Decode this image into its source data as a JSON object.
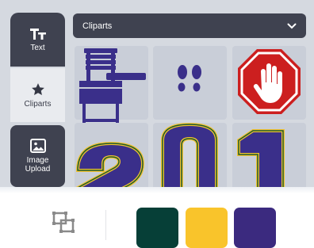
{
  "sidebar": {
    "items": [
      {
        "label": "Text",
        "icon": "text-tt-icon"
      },
      {
        "label": "Cliparts",
        "icon": "star-icon"
      },
      {
        "label": "Image Upload",
        "icon": "image-icon"
      }
    ]
  },
  "dropdown": {
    "value": "Cliparts"
  },
  "cliparts": [
    {
      "name": "school-desk-clipart"
    },
    {
      "name": "footprints-clipart"
    },
    {
      "name": "stop-hand-sign-clipart"
    },
    {
      "name": "number-2-clipart"
    },
    {
      "name": "number-0-clipart"
    },
    {
      "name": "number-1-clipart"
    }
  ],
  "colors": {
    "sidebar_dark": "#3f4250",
    "clipart_navy": "#3a2f8a",
    "stop_red": "#cc1f1f",
    "varsity_green": "#1f5a2c",
    "varsity_gold": "#f2c230"
  },
  "toolbar": {
    "swatches": [
      {
        "name": "dark-green",
        "color": "#063f37"
      },
      {
        "name": "yellow",
        "color": "#f9c42b"
      },
      {
        "name": "purple",
        "color": "#3b2a7f"
      }
    ]
  }
}
